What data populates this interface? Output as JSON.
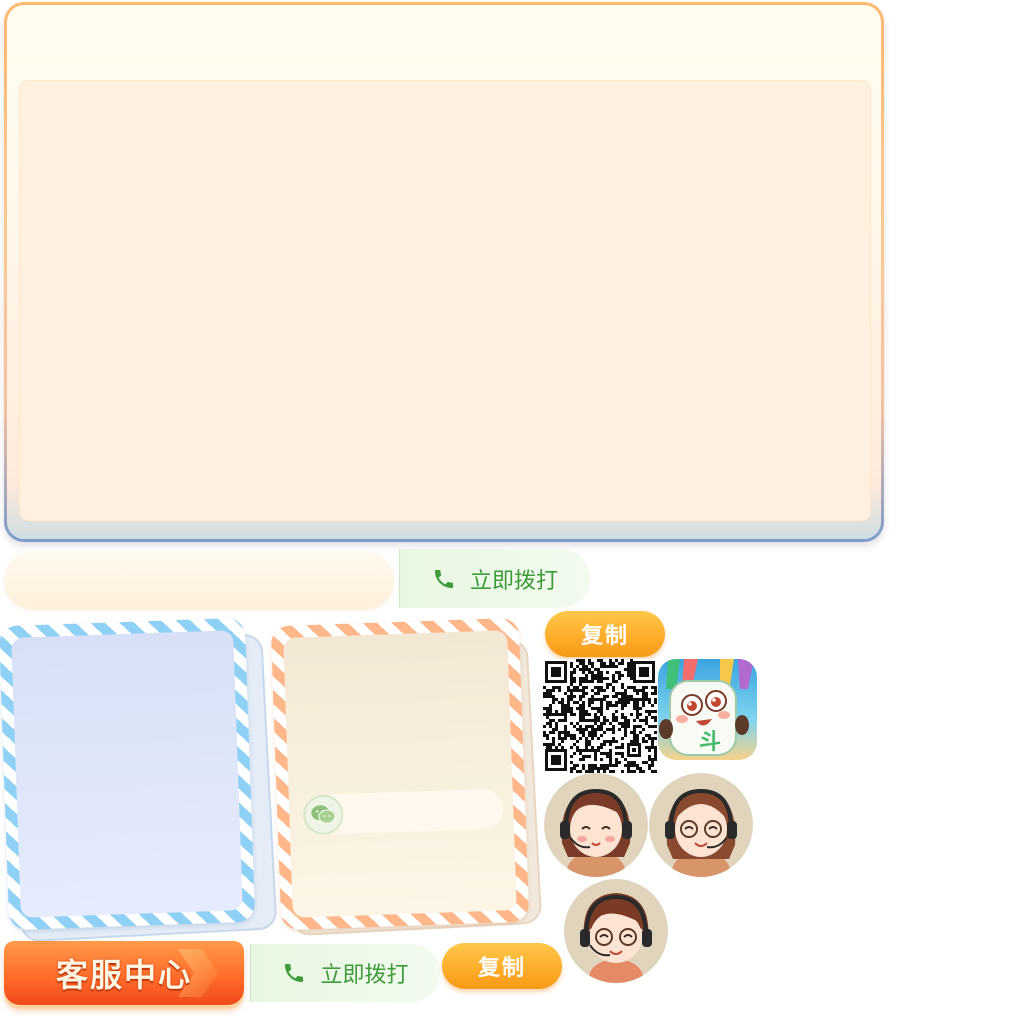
{
  "call_buttons": [
    {
      "label": "立即拨打"
    },
    {
      "label": "立即拨打"
    }
  ],
  "copy_buttons": [
    {
      "label": "复制"
    },
    {
      "label": "复制"
    }
  ],
  "service_center": {
    "title": "客服中心"
  },
  "app_icon": {
    "glyph": "斗"
  },
  "colors": {
    "call_green": "#3f9a3a",
    "copy_orange": "#ffab2a",
    "banner_red": "#f04a1c",
    "panel_border_orange": "#ffb870",
    "panel_border_blue": "#7e9ccd"
  },
  "icons": [
    "phone-icon",
    "wechat-icon",
    "qr-code",
    "app-icon",
    "customer-service-avatar"
  ]
}
